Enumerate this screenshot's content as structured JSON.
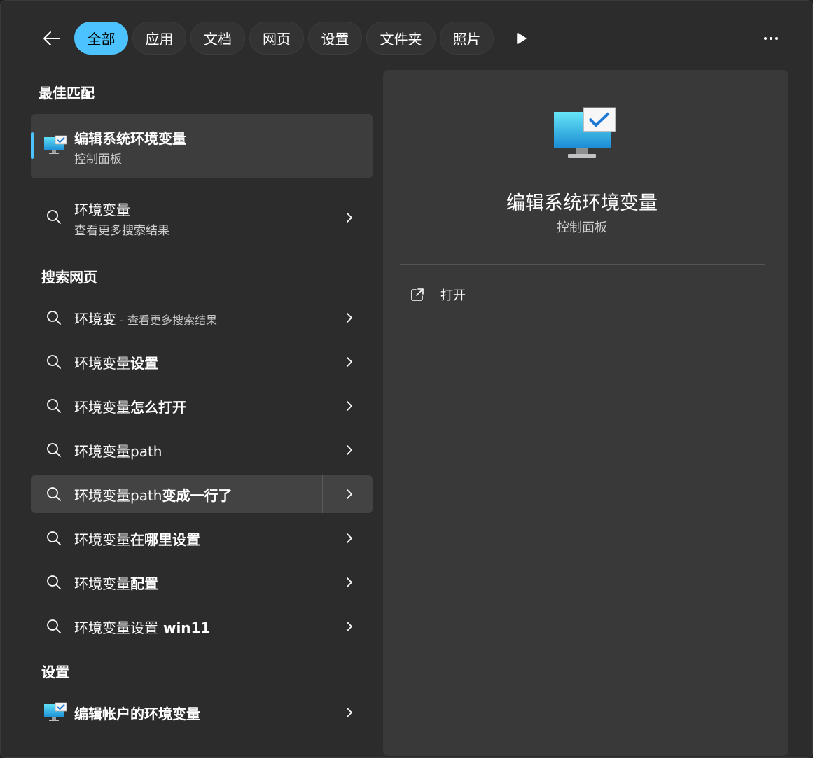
{
  "tabs": [
    "全部",
    "应用",
    "文档",
    "网页",
    "设置",
    "文件夹",
    "照片"
  ],
  "sections": {
    "best_match": "最佳匹配",
    "search_web": "搜索网页",
    "settings": "设置"
  },
  "best_match": {
    "title": "编辑系统环境变量",
    "subtitle": "控制面板"
  },
  "env_result": {
    "title": "环境变量",
    "subtitle": "查看更多搜索结果"
  },
  "web_results": [
    {
      "prefix": "环境变",
      "suffix": " - 查看更多搜索结果"
    },
    {
      "prefix": "环境变量",
      "suffix": "设置"
    },
    {
      "prefix": "环境变量",
      "suffix": "怎么打开"
    },
    {
      "prefix": "环境变量path",
      "suffix": ""
    },
    {
      "prefix": "环境变量path",
      "suffix": "变成一行了"
    },
    {
      "prefix": "环境变量",
      "suffix": "在哪里设置"
    },
    {
      "prefix": "环境变量",
      "suffix": "配置"
    },
    {
      "prefix": "环境变量设置",
      "suffix": " win11"
    }
  ],
  "settings_result": {
    "title": "编辑帐户的环境变量"
  },
  "preview": {
    "title": "编辑系统环境变量",
    "subtitle": "控制面板",
    "open_label": "打开"
  },
  "colors": {
    "accent": "#4cc2ff",
    "panel": "#393939",
    "background": "#2c2c2c"
  }
}
